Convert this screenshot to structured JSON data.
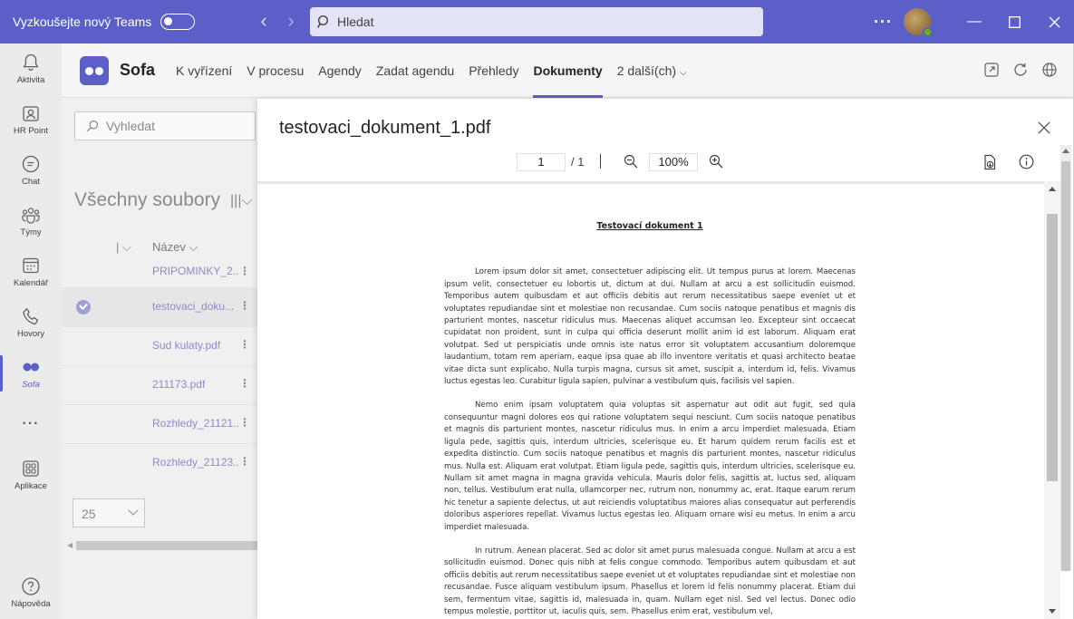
{
  "titlebar": {
    "try_new_teams": "Vyzkoušejte nový Teams",
    "search_placeholder": "Hledat"
  },
  "rail": {
    "items": [
      {
        "label": "Aktivita",
        "icon": "bell-icon"
      },
      {
        "label": "HR Point",
        "icon": "hr-point-icon"
      },
      {
        "label": "Chat",
        "icon": "chat-icon"
      },
      {
        "label": "Týmy",
        "icon": "teams-icon"
      },
      {
        "label": "Kalendář",
        "icon": "calendar-icon"
      },
      {
        "label": "Hovory",
        "icon": "phone-icon"
      },
      {
        "label": "Sofa",
        "icon": "sofa-app-icon"
      },
      {
        "label": "Aplikace",
        "icon": "apps-icon"
      },
      {
        "label": "Nápověda",
        "icon": "help-icon"
      }
    ]
  },
  "app": {
    "name": "Sofa",
    "tabs": [
      "K vyřízení",
      "V procesu",
      "Agendy",
      "Zadat agendu",
      "Přehledy",
      "Dokumenty",
      "2 další(ch)"
    ],
    "active_tab": "Dokumenty",
    "accent": "#5b5fc7"
  },
  "files": {
    "search_placeholder": "Vyhledat",
    "title": "Všechny soubory",
    "column_name": "Název",
    "rows": [
      "PRIPOMINKY_2...",
      "testovaci_doku...",
      "Sud kulaty.pdf",
      "211173.pdf",
      "Rozhledy_21121...",
      "Rozhledy_21123..."
    ],
    "selected_row": 1,
    "page_size": "25"
  },
  "viewer": {
    "filename": "testovaci_dokument_1.pdf",
    "page_current": "1",
    "page_total": "/ 1",
    "zoom": "100%",
    "document": {
      "heading": "Testovací dokument 1",
      "paragraphs": [
        "Lorem ipsum dolor sit amet, consectetuer adipiscing elit. Ut tempus purus at lorem. Maecenas ipsum velit, consectetuer eu lobortis ut, dictum at dui. Nullam at arcu a est sollicitudin euismod. Temporibus autem quibusdam et aut officiis debitis aut rerum necessitatibus saepe eveniet ut et voluptates repudiandae sint et molestiae non recusandae. Cum sociis natoque penatibus et magnis dis parturient montes, nascetur ridiculus mus. Maecenas aliquet accumsan leo. Excepteur sint occaecat cupidatat non proident, sunt in culpa qui officia deserunt mollit anim id est laborum. Aliquam erat volutpat. Sed ut perspiciatis unde omnis iste natus error sit voluptatem accusantium doloremque laudantium, totam rem aperiam, eaque ipsa quae ab illo inventore veritatis et quasi architecto beatae vitae dicta sunt explicabo. Nulla turpis magna, cursus sit amet, suscipit a, interdum id, felis. Vivamus luctus egestas leo. Curabitur ligula sapien, pulvinar a vestibulum quis, facilisis vel sapien.",
        "Nemo enim ipsam voluptatem quia voluptas sit aspernatur aut odit aut fugit, sed quia consequuntur magni dolores eos qui ratione voluptatem sequi nesciunt. Cum sociis natoque penatibus et magnis dis parturient montes, nascetur ridiculus mus. In enim a arcu imperdiet malesuada. Etiam ligula pede, sagittis quis, interdum ultricies, scelerisque eu. Et harum quidem rerum facilis est et expedita distinctio. Cum sociis natoque penatibus et magnis dis parturient montes, nascetur ridiculus mus. Nulla est. Aliquam erat volutpat. Etiam ligula pede, sagittis quis, interdum ultricies, scelerisque eu. Nullam sit amet magna in magna gravida vehicula. Mauris dolor felis, sagittis at, luctus sed, aliquam non, tellus. Vestibulum erat nulla, ullamcorper nec, rutrum non, nonummy ac, erat. Itaque earum rerum hic tenetur a sapiente delectus, ut aut reiciendis voluptatibus maiores alias consequatur aut perferendis doloribus asperiores repellat. Vivamus luctus egestas leo. Aliquam ornare wisi eu metus. In enim a arcu imperdiet malesuada.",
        "In rutrum. Aenean placerat. Sed ac dolor sit amet purus malesuada congue. Nullam at arcu a est sollicitudin euismod. Donec quis nibh at felis congue commodo. Temporibus autem quibusdam et aut officiis debitis aut rerum necessitatibus saepe eveniet ut et voluptates repudiandae sint et molestiae non recusandae. Fusce aliquam vestibulum ipsum. Phasellus et lorem id felis nonummy placerat. Etiam dui sem, fermentum vitae, sagittis id, malesuada in, quam. Nullam eget nisl. Sed vel lectus. Donec odio tempus molestie, porttitor ut, iaculis quis, sem. Phasellus enim erat, vestibulum vel,"
      ]
    }
  }
}
